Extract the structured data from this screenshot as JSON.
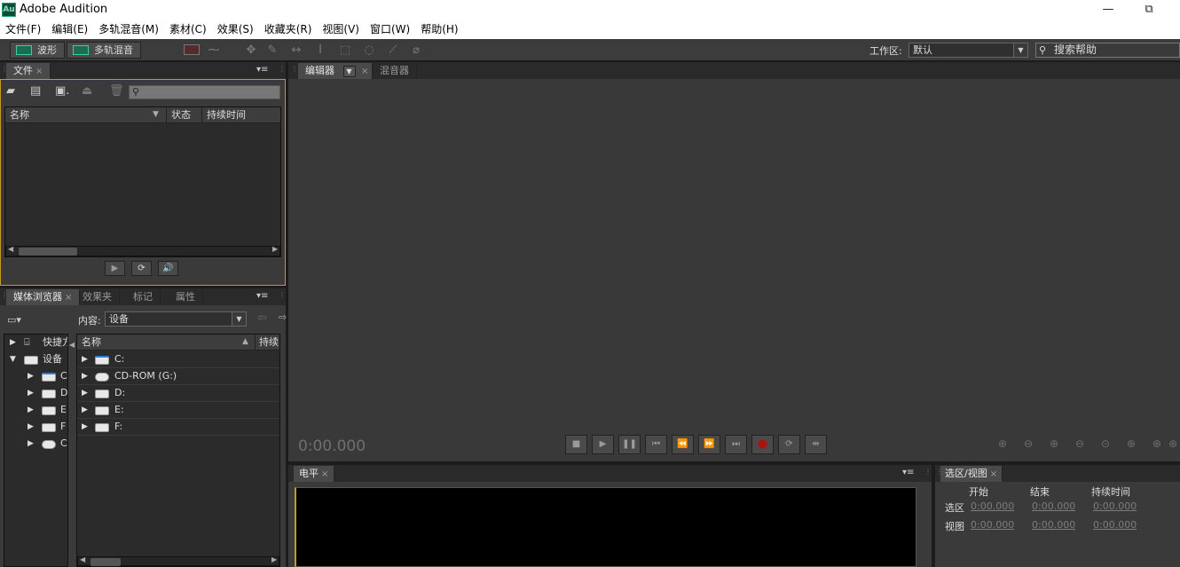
{
  "window": {
    "title": "Adobe Audition",
    "logo": "Au",
    "minimize_icon": "—",
    "restore_icon": "⧉"
  },
  "menu": [
    "文件(F)",
    "编辑(E)",
    "多轨混音(M)",
    "素材(C)",
    "效果(S)",
    "收藏夹(R)",
    "视图(V)",
    "窗口(W)",
    "帮助(H)"
  ],
  "toolbar": {
    "waveform_label": "波形",
    "multitrack_label": "多轨混音",
    "workspace_label": "工作区:",
    "workspace_value": "默认",
    "search_help_placeholder": "搜索帮助"
  },
  "files_panel": {
    "tab": "文件",
    "columns": {
      "name": "名称",
      "status": "状态",
      "duration": "持续时间"
    }
  },
  "media_panel": {
    "tabs": [
      "媒体浏览器",
      "效果夹",
      "标记",
      "属性"
    ],
    "content_label": "内容:",
    "content_value": "设备",
    "tree": [
      {
        "label": "快捷方",
        "icon": "shortcuts-icon"
      },
      {
        "label": "设备",
        "icon": "drive-icon"
      },
      {
        "label": "C",
        "icon": "system-drive-icon"
      },
      {
        "label": "D",
        "icon": "drive-icon"
      },
      {
        "label": "E",
        "icon": "drive-icon"
      },
      {
        "label": "F",
        "icon": "drive-icon"
      },
      {
        "label": "C",
        "icon": "cdrom-drive-icon"
      }
    ],
    "list_columns": {
      "name": "名称",
      "duration": "持续"
    },
    "list": [
      {
        "label": "C:",
        "icon": "system-drive-icon"
      },
      {
        "label": "CD-ROM (G:)",
        "icon": "cdrom-drive-icon"
      },
      {
        "label": "D:",
        "icon": "drive-icon"
      },
      {
        "label": "E:",
        "icon": "drive-icon"
      },
      {
        "label": "F:",
        "icon": "drive-icon"
      }
    ]
  },
  "editor": {
    "tabs": [
      "编辑器",
      "混音器"
    ],
    "timecode": "0:00.000"
  },
  "levels_panel": {
    "tab": "电平"
  },
  "selection_panel": {
    "tab": "选区/视图",
    "headers": {
      "start": "开始",
      "end": "结束",
      "duration": "持续时间"
    },
    "rows": [
      {
        "label": "选区",
        "start": "0:00.000",
        "end": "0:00.000",
        "duration": "0:00.000"
      },
      {
        "label": "视图",
        "start": "0:00.000",
        "end": "0:00.000",
        "duration": "0:00.000"
      }
    ]
  },
  "colors": {
    "accent_border": "#c69b1a",
    "record": "#b01010",
    "waveform_icon": "#3fcfa0"
  }
}
